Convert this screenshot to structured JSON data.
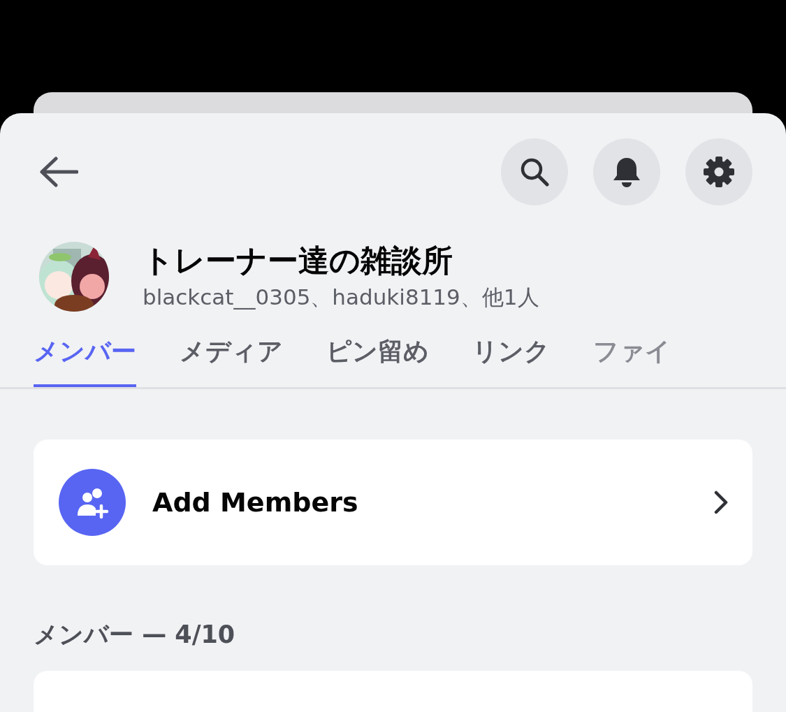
{
  "group": {
    "title": "トレーナー達の雑談所",
    "members_line": "blackcat__0305、haduki8119、他1人"
  },
  "tabs": [
    {
      "label": "メンバー",
      "selected": true
    },
    {
      "label": "メディア",
      "selected": false
    },
    {
      "label": "ピン留め",
      "selected": false
    },
    {
      "label": "リンク",
      "selected": false
    },
    {
      "label": "ファイ",
      "selected": false
    }
  ],
  "add_members": {
    "label": "Add Members"
  },
  "section": {
    "title": "メンバー — 4/10"
  }
}
